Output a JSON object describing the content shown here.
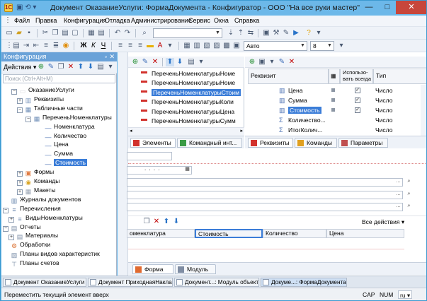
{
  "window": {
    "title": "Документ ОказаниеУслуги: ФормаДокумента - Конфигуратор - ООО \"На все руки мастер\"",
    "logo": "1С",
    "btn_min": "—",
    "btn_max": "□",
    "btn_close": "✕"
  },
  "menu": [
    "Файл",
    "Правка",
    "Конфигурация",
    "Отладка",
    "Администрирование",
    "Сервис",
    "Окна",
    "Справка"
  ],
  "toolbar2": {
    "bold": "Ж",
    "italic": "К",
    "underline": "Ч",
    "font_size_value": "Авто",
    "font_value": "8"
  },
  "left_panel": {
    "title": "Конфигурация",
    "actions_label": "Действия ▾",
    "search_placeholder": "Поиск (Ctrl+Alt+M)",
    "tree": [
      {
        "label": "ОказаниеУслуги",
        "icon": "document-icon",
        "exp": "−"
      },
      {
        "label": "Реквизиты",
        "icon": "requisites-icon",
        "exp": "+"
      },
      {
        "label": "Табличные части",
        "icon": "table-icon",
        "exp": "−"
      },
      {
        "label": "ПереченьНоменклатуры",
        "icon": "table-icon",
        "exp": "−"
      },
      {
        "label": "Номенклатура",
        "icon": "dash-icon",
        "exp": ""
      },
      {
        "label": "Количество",
        "icon": "dash-icon",
        "exp": ""
      },
      {
        "label": "Цена",
        "icon": "dash-icon",
        "exp": ""
      },
      {
        "label": "Сумма",
        "icon": "dash-icon",
        "exp": ""
      },
      {
        "label": "Стоимость",
        "icon": "dash-icon",
        "exp": "",
        "selected": true
      },
      {
        "label": "Формы",
        "icon": "form-icon",
        "exp": "+"
      },
      {
        "label": "Команды",
        "icon": "command-icon",
        "exp": "+"
      },
      {
        "label": "Макеты",
        "icon": "template-icon",
        "exp": "+"
      },
      {
        "label": "Журналы документов",
        "icon": "journal-icon",
        "exp": ""
      },
      {
        "label": "Перечисления",
        "icon": "enum-icon",
        "exp": "−"
      },
      {
        "label": "ВидыНоменклатуры",
        "icon": "enum-icon",
        "exp": "+"
      },
      {
        "label": "Отчеты",
        "icon": "report-icon",
        "exp": "−"
      },
      {
        "label": "Материалы",
        "icon": "report-icon",
        "exp": "+"
      },
      {
        "label": "Обработки",
        "icon": "processing-icon",
        "exp": ""
      },
      {
        "label": "Планы видов характеристик",
        "icon": "plan-icon",
        "exp": ""
      },
      {
        "label": "Планы счетов",
        "icon": "accounts-icon",
        "exp": ""
      }
    ]
  },
  "form_elements": [
    "ПереченьНоменклатурыНоме",
    "ПереченьНоменклатурыНоме",
    "ПереченьНоменклатурыСтоим",
    "ПереченьНоменклатурыКоли",
    "ПереченьНоменклатурыЦена",
    "ПереченьНоменклатурыСумм"
  ],
  "requisites": {
    "headers": [
      "Реквизит",
      "Использо-вать всегда",
      "Тип"
    ],
    "rows": [
      {
        "name": "Цена",
        "always": true,
        "type": "Число"
      },
      {
        "name": "Сумма",
        "always": true,
        "type": "Число"
      },
      {
        "name": "Стоимость",
        "always": true,
        "type": "Число",
        "selected": true
      },
      {
        "name": "Количество...",
        "always": false,
        "type": "Число"
      },
      {
        "name": "ИтогКолич...",
        "always": false,
        "type": "Число"
      }
    ]
  },
  "tabs_left": [
    "Элементы",
    "Командный инт..."
  ],
  "tabs_right": [
    "Реквизиты",
    "Команды",
    "Параметры"
  ],
  "preview": {
    "dots": ". . . .",
    "all_actions": "Все действия ▾",
    "columns": [
      "оменклатура",
      "Стоимость",
      "Количество",
      "Цена"
    ]
  },
  "bottom_tabs": [
    "Форма",
    "Модуль"
  ],
  "taskbar": [
    "Документ ОказаниеУслуги",
    "Документ ПриходнаяНакла...",
    "Докумeнт...: Модуль объекта",
    "Докуме...: ФормаДокумента"
  ],
  "status": {
    "text": "Переместить текущий элемент вверх",
    "cap": "CAP",
    "num": "NUM",
    "lang": "ru ▾"
  },
  "colors": {
    "title_bar": "#6cb8e9",
    "selection": "#3b7dd8",
    "close_button": "#c7463b",
    "red_marker": "#d2322d"
  }
}
